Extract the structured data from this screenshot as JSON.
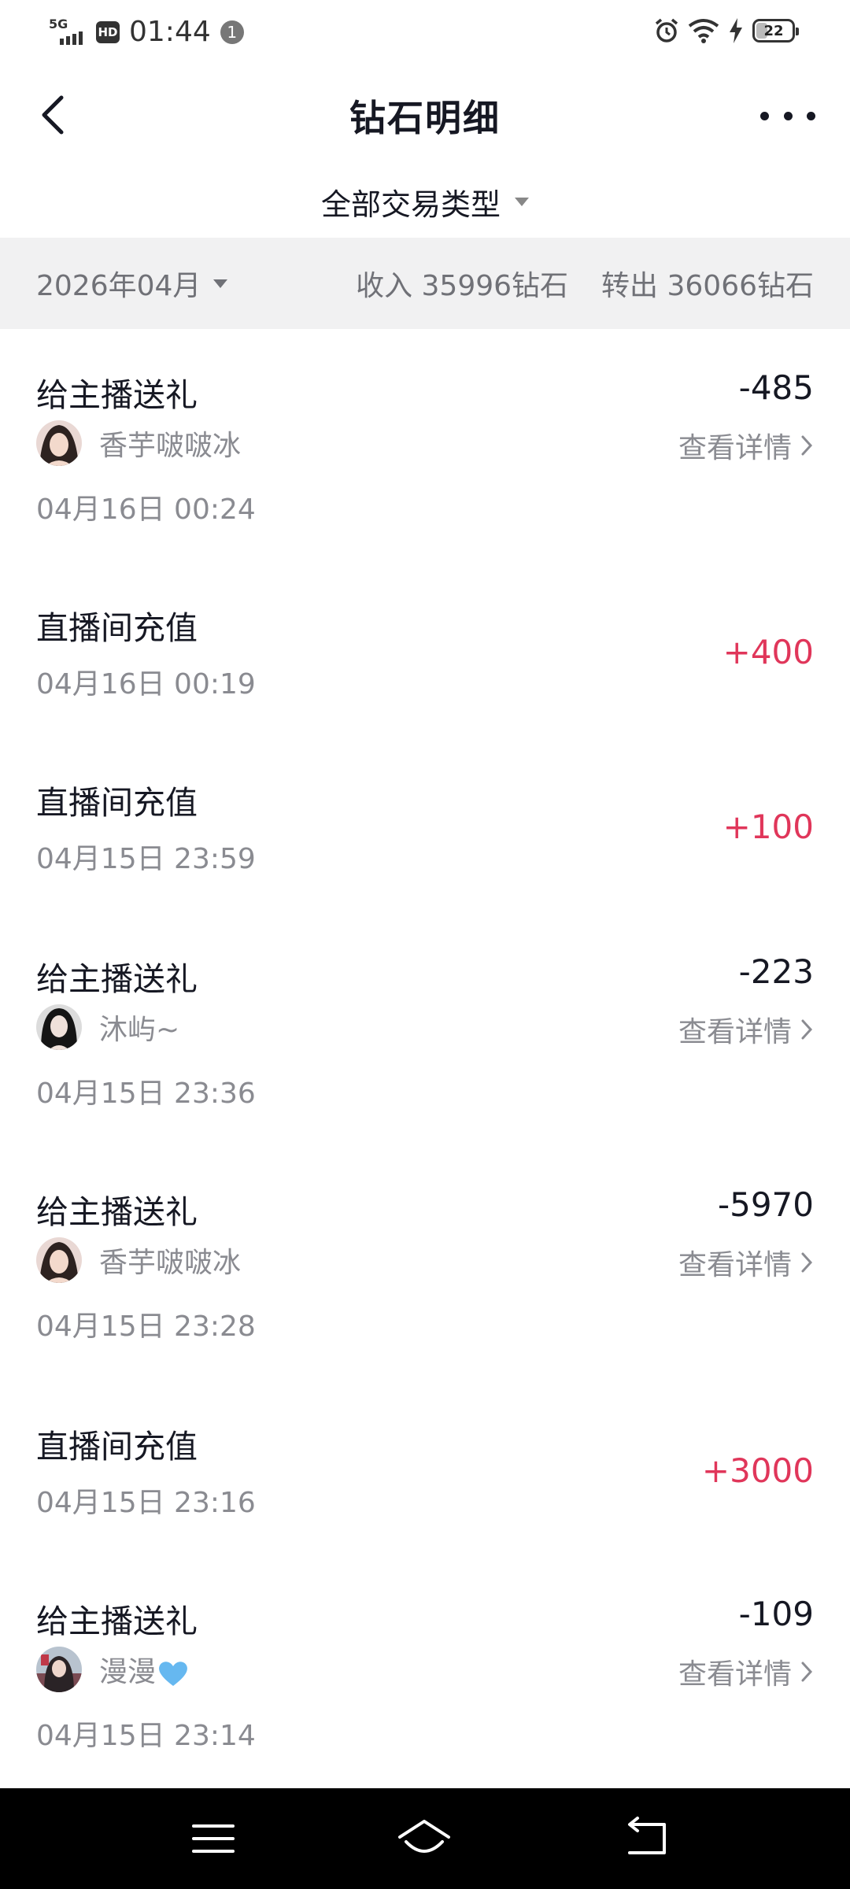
{
  "status_bar": {
    "network": "5G",
    "hd": "HD",
    "time": "01:44",
    "notification_count": "1",
    "battery": "22"
  },
  "header": {
    "title": "钻石明细"
  },
  "filter": {
    "label": "全部交易类型"
  },
  "summary": {
    "month": "2026年04月",
    "income": "收入 35996钻石",
    "outgoing": "转出 36066钻石"
  },
  "transactions": [
    {
      "title": "给主播送礼",
      "amount": "-485",
      "user": "香芋啵啵冰",
      "detail": "查看详情",
      "time": "04月16日 00:24"
    },
    {
      "title": "直播间充值",
      "amount": "+400",
      "time": "04月16日 00:19"
    },
    {
      "title": "直播间充值",
      "amount": "+100",
      "time": "04月15日 23:59"
    },
    {
      "title": "给主播送礼",
      "amount": "-223",
      "user": "沐屿~",
      "detail": "查看详情",
      "time": "04月15日 23:36"
    },
    {
      "title": "给主播送礼",
      "amount": "-5970",
      "user": "香芋啵啵冰",
      "detail": "查看详情",
      "time": "04月15日 23:28"
    },
    {
      "title": "直播间充值",
      "amount": "+3000",
      "time": "04月15日 23:16"
    },
    {
      "title": "给主播送礼",
      "amount": "-109",
      "user": "漫漫",
      "detail": "查看详情",
      "time": "04月15日 23:14"
    }
  ],
  "colors": {
    "positive_amount": "#e0365a",
    "summary_background": "#f1f1f2",
    "secondary_text": "#8a8b91"
  }
}
